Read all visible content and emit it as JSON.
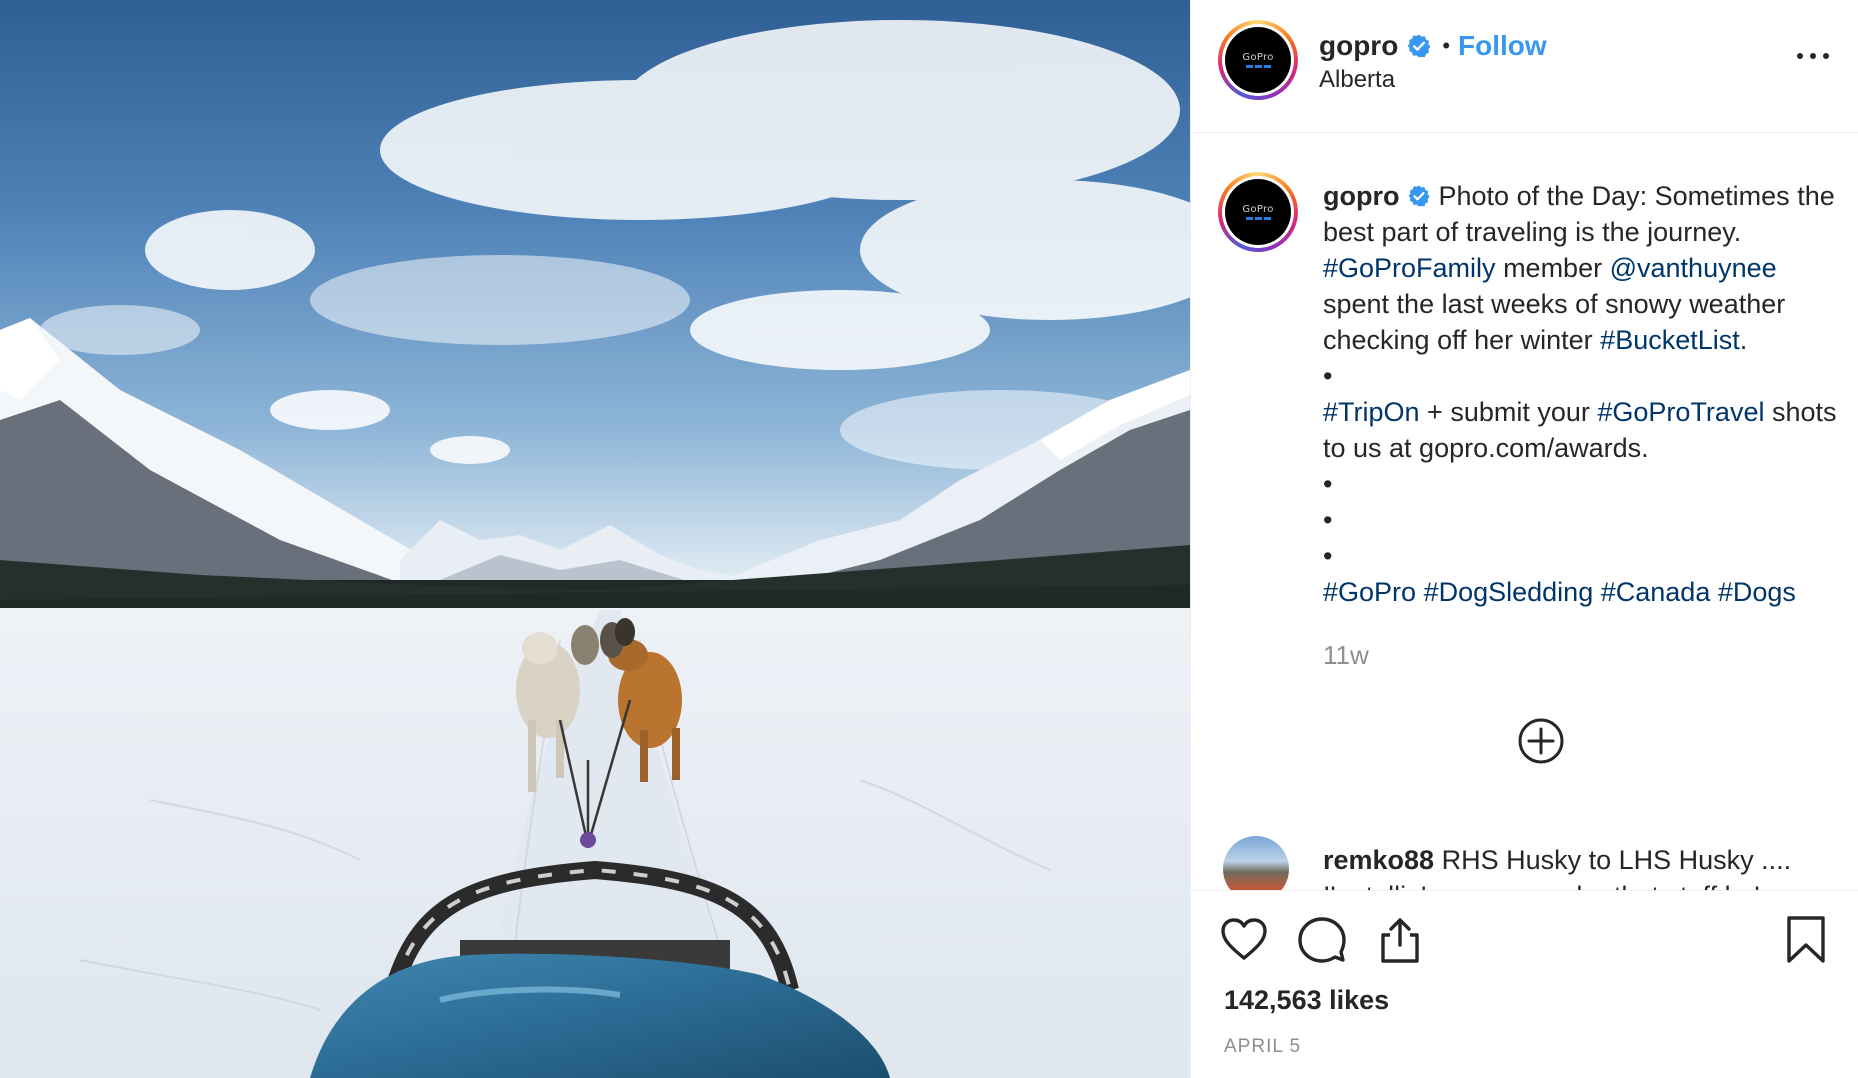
{
  "post": {
    "image_alt": "Dog sled team pulling across a snowy valley between mountains",
    "author": {
      "username": "gopro",
      "verified": true,
      "avatar_text": "GoPro",
      "location": "Alberta"
    },
    "follow_separator": "•",
    "follow_label": "Follow",
    "more_icon": "more-options-icon",
    "caption": {
      "username": "gopro",
      "line1": "Photo of the Day: Sometimes the best part of traveling is the journey.",
      "tag_family": "#GoProFamily",
      "member_word": "member",
      "mention": "@vanthuynee",
      "line2": "spent the last weeks of snowy weather checking off her winter",
      "tag_bucket": "#BucketList",
      "period": ".",
      "bullet": "•",
      "tag_tripon": "#TripOn",
      "submit_text": "+ submit your",
      "tag_travel": "#GoProTravel",
      "line3": "shots to us at gopro.com/awards.",
      "tags_final": [
        "#GoPro",
        "#DogSledding",
        "#Canada",
        "#Dogs"
      ]
    },
    "timestamp": "11w",
    "load_more_icon": "plus-circle-icon",
    "comment": {
      "username": "remko88",
      "text": "RHS Husky to LHS Husky ....",
      "text_cont": "I'm tellin' ya man, under that stuff he's"
    },
    "actions": [
      "heart-icon",
      "comment-icon",
      "share-icon",
      "bookmark-icon"
    ],
    "likes": "142,563 likes",
    "date": "APRIL 5"
  },
  "colors": {
    "link": "#003569",
    "follow": "#3897f0",
    "verified": "#3897f0",
    "muted": "#8e8e8e"
  }
}
